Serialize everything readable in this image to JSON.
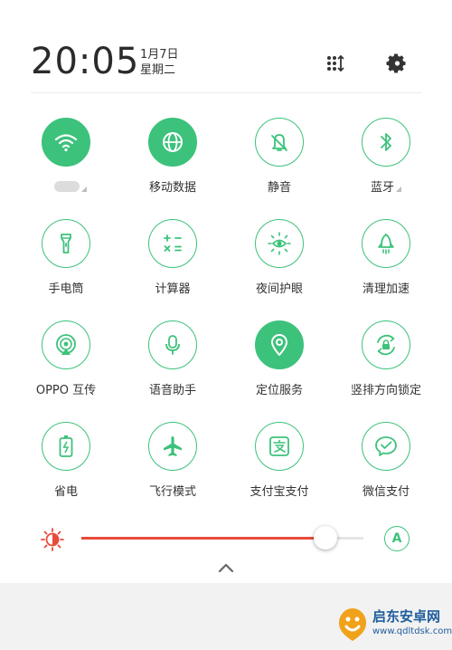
{
  "header": {
    "time": "20:05",
    "date_line1": "1月7日",
    "date_line2": "星期二"
  },
  "tiles": [
    {
      "label": "",
      "icon": "wifi-icon",
      "active": true
    },
    {
      "label": "移动数据",
      "icon": "globe-icon",
      "active": true
    },
    {
      "label": "静音",
      "icon": "bell-icon",
      "active": false
    },
    {
      "label": "蓝牙",
      "icon": "bluetooth-icon",
      "active": false
    },
    {
      "label": "手电筒",
      "icon": "flashlight-icon",
      "active": false
    },
    {
      "label": "计算器",
      "icon": "calculator-icon",
      "active": false
    },
    {
      "label": "夜间护眼",
      "icon": "eye-sun-icon",
      "active": false
    },
    {
      "label": "清理加速",
      "icon": "rocket-icon",
      "active": false
    },
    {
      "label": "OPPO 互传",
      "icon": "share-icon",
      "active": false
    },
    {
      "label": "语音助手",
      "icon": "microphone-icon",
      "active": false
    },
    {
      "label": "定位服务",
      "icon": "location-icon",
      "active": true
    },
    {
      "label": "竖排方向锁定",
      "icon": "rotation-lock-icon",
      "active": false
    },
    {
      "label": "省电",
      "icon": "battery-icon",
      "active": false
    },
    {
      "label": "飞行模式",
      "icon": "airplane-icon",
      "active": false
    },
    {
      "label": "支付宝支付",
      "icon": "alipay-icon",
      "active": false
    },
    {
      "label": "微信支付",
      "icon": "wechat-pay-icon",
      "active": false
    }
  ],
  "brightness": {
    "level": 0.865,
    "auto_label": "A"
  },
  "watermark": {
    "name": "启东安卓网",
    "url": "www.qdltdsk.com"
  },
  "colors": {
    "accent": "#3cc27b",
    "slider": "#e84a3a"
  }
}
